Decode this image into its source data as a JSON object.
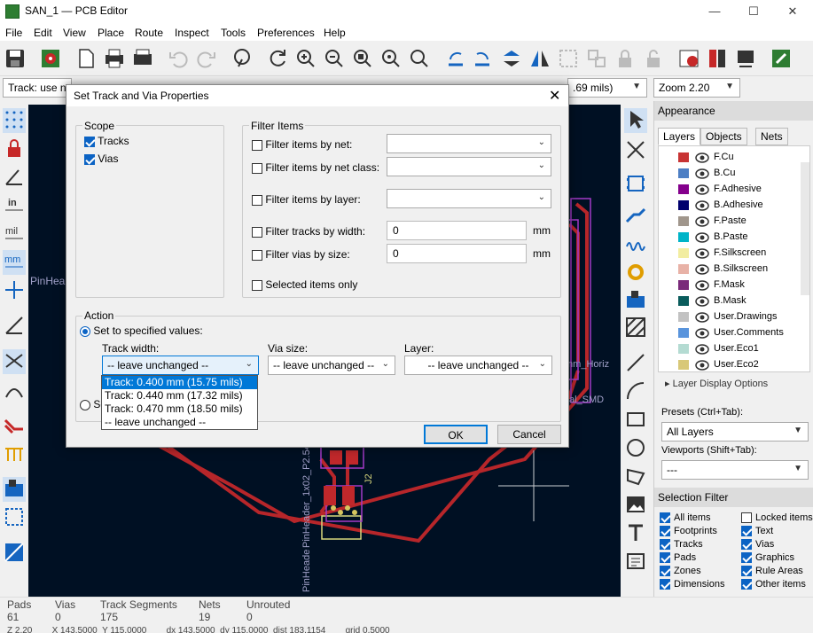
{
  "window": {
    "title": "SAN_1 — PCB Editor",
    "minimize": "—",
    "maximize": "☐",
    "close": "✕"
  },
  "menu": [
    "File",
    "Edit",
    "View",
    "Place",
    "Route",
    "Inspect",
    "Tools",
    "Preferences",
    "Help"
  ],
  "optbar": {
    "track_combo": "Track: use ne",
    "via_combo": ".69 mils)",
    "zoom": "Zoom 2.20"
  },
  "canvas_labels": {
    "pinhead_left": "PinHea",
    "comp_vertical_1": "PinHeader_1x02_P2.54mm",
    "comp_vertical_2": "PinHeade",
    "j2": "J2",
    "mm_horiz": "mm_Horiz",
    "al_smd": "al_SMD"
  },
  "appearance": {
    "title": "Appearance",
    "tabs": [
      "Layers",
      "Objects",
      "Nets"
    ],
    "layers": [
      {
        "name": "F.Cu",
        "color": "#c83434"
      },
      {
        "name": "B.Cu",
        "color": "#4d7fc4"
      },
      {
        "name": "F.Adhesive",
        "color": "#84008c"
      },
      {
        "name": "B.Adhesive",
        "color": "#00006e"
      },
      {
        "name": "F.Paste",
        "color": "#a0968c"
      },
      {
        "name": "B.Paste",
        "color": "#00b4c8"
      },
      {
        "name": "F.Silkscreen",
        "color": "#f2eda1"
      },
      {
        "name": "B.Silkscreen",
        "color": "#e8b2a7"
      },
      {
        "name": "F.Mask",
        "color": "#7a2a7a"
      },
      {
        "name": "B.Mask",
        "color": "#0a5c5c"
      },
      {
        "name": "User.Drawings",
        "color": "#c2c2c2"
      },
      {
        "name": "User.Comments",
        "color": "#5994dc"
      },
      {
        "name": "User.Eco1",
        "color": "#b4dbd2"
      },
      {
        "name": "User.Eco2",
        "color": "#d8c878"
      }
    ],
    "layer_display_options": "Layer Display Options",
    "presets_label": "Presets (Ctrl+Tab):",
    "presets_value": "All Layers",
    "viewports_label": "Viewports (Shift+Tab):",
    "viewports_value": "---"
  },
  "selection_filter": {
    "title": "Selection Filter",
    "left": [
      {
        "label": "All items",
        "checked": true
      },
      {
        "label": "Footprints",
        "checked": true
      },
      {
        "label": "Tracks",
        "checked": true
      },
      {
        "label": "Pads",
        "checked": true
      },
      {
        "label": "Zones",
        "checked": true
      },
      {
        "label": "Dimensions",
        "checked": true
      }
    ],
    "right": [
      {
        "label": "Locked items",
        "checked": false
      },
      {
        "label": "Text",
        "checked": true
      },
      {
        "label": "Vias",
        "checked": true
      },
      {
        "label": "Graphics",
        "checked": true
      },
      {
        "label": "Rule Areas",
        "checked": true
      },
      {
        "label": "Other items",
        "checked": true
      }
    ]
  },
  "status": {
    "headers": [
      "Pads",
      "Vias",
      "Track Segments",
      "Nets",
      "Unrouted"
    ],
    "values": [
      "61",
      "0",
      "175",
      "19",
      "0"
    ],
    "bottom": "Z 2.20        X 143.5000  Y 115.0000        dx 143.5000  dy 115.0000  dist 183.1154        grid 0.5000"
  },
  "dialog": {
    "title": "Set Track and Via Properties",
    "scope_title": "Scope",
    "scope_tracks": "Tracks",
    "scope_vias": "Vias",
    "filter_title": "Filter Items",
    "f_net": "Filter items by net:",
    "f_netclass": "Filter items by net class:",
    "f_layer": "Filter items by layer:",
    "f_width": "Filter tracks by width:",
    "f_width_val": "0",
    "f_via": "Filter vias by size:",
    "f_via_val": "0",
    "unit": "mm",
    "selected_only": "Selected items only",
    "action_title": "Action",
    "set_specified": "Set to specified values:",
    "track_width_label": "Track width:",
    "track_width_value": "-- leave unchanged --",
    "via_size_label": "Via size:",
    "via_size_value": "-- leave unchanged --",
    "layer_label": "Layer:",
    "layer_value": "-- leave unchanged --",
    "set_netclass_partial": "Se",
    "ok": "OK",
    "cancel": "Cancel",
    "dropdown_options": [
      "Track: 0.400 mm (15.75 mils)",
      "Track: 0.440 mm (17.32 mils)",
      "Track: 0.470 mm (18.50 mils)",
      "-- leave unchanged --"
    ]
  }
}
